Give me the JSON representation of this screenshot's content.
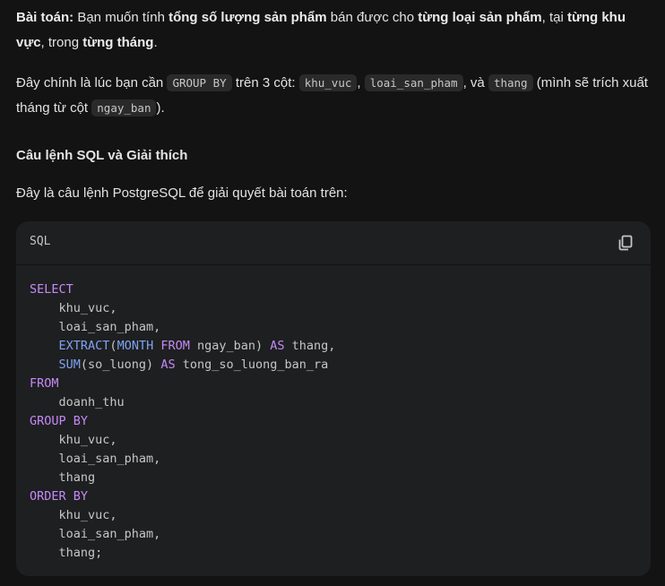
{
  "intro": {
    "label": "Bài toán:",
    "t1": " Bạn muốn tính ",
    "b1": "tổng số lượng sản phẩm",
    "t2": " bán được cho ",
    "b2": "từng loại sản phẩm",
    "t3": ", tại ",
    "b3": "từng khu vực",
    "t4": ", trong ",
    "b4": "từng tháng",
    "t5": "."
  },
  "explain": {
    "t1": "Đây chính là lúc bạn cần ",
    "c1": "GROUP BY",
    "t2": " trên 3 cột: ",
    "c2": "khu_vuc",
    "t3": ", ",
    "c3": "loai_san_pham",
    "t4": ", và ",
    "c4": "thang",
    "t5": " (mình sẽ trích xuất tháng từ cột ",
    "c5": "ngay_ban",
    "t6": ")."
  },
  "section_title": "Câu lệnh SQL và Giải thích",
  "lead": "Đây là câu lệnh PostgreSQL để giải quyết bài toán trên:",
  "code_block": {
    "language": "SQL",
    "copy_icon": "copy-icon",
    "tokens": {
      "select": "SELECT",
      "col1": "    khu_vuc,",
      "col2": "    loai_san_pham,",
      "extract": "EXTRACT",
      "open_paren": "(",
      "month": "MONTH",
      "from_kw": "FROM",
      "ngay_ban_paren": " ngay_ban) ",
      "as1": "AS",
      "thang_alias": " thang,",
      "sum": "SUM",
      "so_luong": "(so_luong) ",
      "as2": "AS",
      "tong_alias": " tong_so_luong_ban_ra",
      "from": "FROM",
      "table": "    doanh_thu",
      "group_by": "GROUP BY",
      "g1": "    khu_vuc,",
      "g2": "    loai_san_pham,",
      "g3": "    thang",
      "order_by": "ORDER BY",
      "o1": "    khu_vuc,",
      "o2": "    loai_san_pham,",
      "o3": "    thang;"
    }
  }
}
